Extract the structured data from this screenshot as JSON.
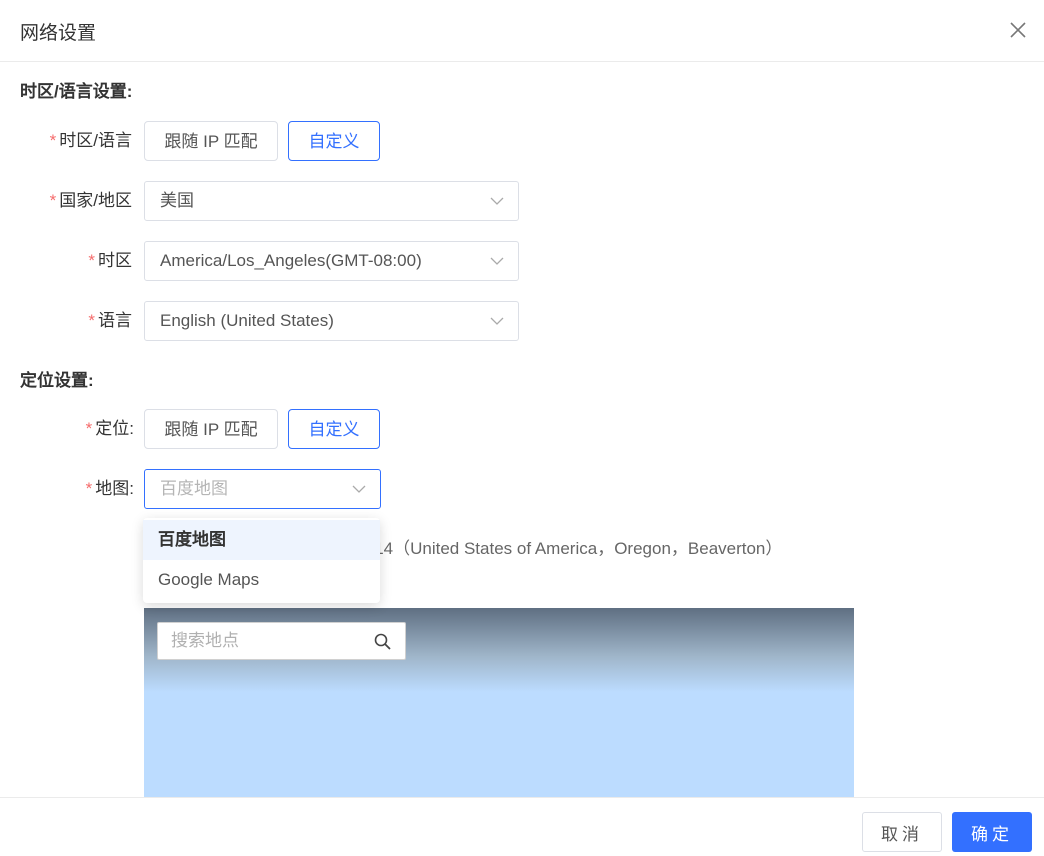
{
  "dialog": {
    "title": "网络设置"
  },
  "timezone_section": {
    "title": "时区/语言设置:",
    "tz_lang": {
      "label": "时区/语言",
      "options": [
        "跟随 IP 匹配",
        "自定义"
      ],
      "selected": "自定义"
    },
    "country": {
      "label": "国家/地区",
      "value": "美国"
    },
    "timezone": {
      "label": "时区",
      "value": "America/Los_Angeles(GMT-08:00)"
    },
    "language": {
      "label": "语言",
      "value": "English (United States)"
    }
  },
  "location_section": {
    "title": "定位设置:",
    "location": {
      "label": "定位:",
      "options": [
        "跟随 IP 匹配",
        "自定义"
      ],
      "selected": "自定义"
    },
    "map": {
      "label": "地图:",
      "placeholder": "百度地图",
      "dropdown_options": [
        "百度地图",
        "Google Maps"
      ],
      "highlighted": "百度地图"
    },
    "coordinates_partial": "114（United States of America，Oregon，Beaverton）",
    "search": {
      "placeholder": "搜索地点"
    }
  },
  "footer": {
    "cancel": "取消",
    "confirm": "确定"
  },
  "colors": {
    "accent": "#3370ff",
    "required": "#f56c6c",
    "highlight_bg": "#eef4fe"
  },
  "icons": {
    "close": "close-icon",
    "chevron": "chevron-down-icon",
    "search": "search-icon"
  }
}
